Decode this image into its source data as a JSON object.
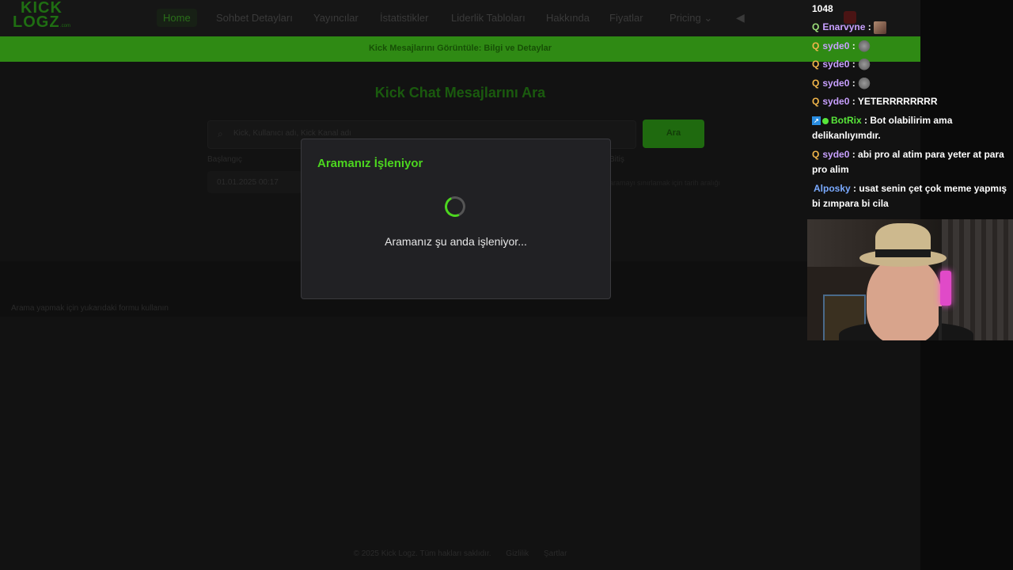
{
  "site": {
    "logo": {
      "line1": "KICK",
      "line2": "LOGZ",
      "suffix": ".com"
    },
    "nav": [
      "Home",
      "Sohbet Detayları",
      "Yayıncılar",
      "İstatistikler",
      "Liderlik Tabloları",
      "Hakkında",
      "Fiyatlar",
      "Pricing"
    ],
    "banner": "Kick Mesajlarını Görüntüle: Bilgi ve Detaylar",
    "title": "Kick Chat Mesajlarını Ara",
    "search_placeholder": "Kick, Kullanıcı adı, Kick Kanal adı",
    "search_button": "Ara",
    "label_start": "Başlangıç",
    "label_end": "Bitiş",
    "date_value": "01.01.2025 00:17",
    "hint": "aramayı sınırlamak için tarih aralığı",
    "note": "Arama yapmak için yukarıdaki formu kullanın",
    "footer": [
      "© 2025 Kick Logz. Tüm hakları saklıdır.",
      "Gizlilik",
      "Şartlar"
    ]
  },
  "modal": {
    "title": "Aramanız İşleniyor",
    "message": "Aramanız şu anda işleniyor...",
    "accent": "#4cd61f"
  },
  "chat": {
    "viewer_count": "1048",
    "messages": [
      {
        "user": "Enarvyne",
        "text": "",
        "emote": "face"
      },
      {
        "user": "syde0",
        "text": "",
        "emote": "stone"
      },
      {
        "user": "syde0",
        "text": "",
        "emote": "stone"
      },
      {
        "user": "syde0",
        "text": "",
        "emote": "stone"
      },
      {
        "user": "syde0",
        "text": "YETERRRRRRRR"
      },
      {
        "user": "BotRix",
        "text": "Bot olabilirim ama delikanlıyımdır."
      },
      {
        "user": "syde0",
        "text": "abi pro al atim para yeter at para pro alim"
      },
      {
        "user": "Alposky",
        "text": "usat senin çet çok meme yapmış bi zımpara bi cila"
      }
    ]
  }
}
